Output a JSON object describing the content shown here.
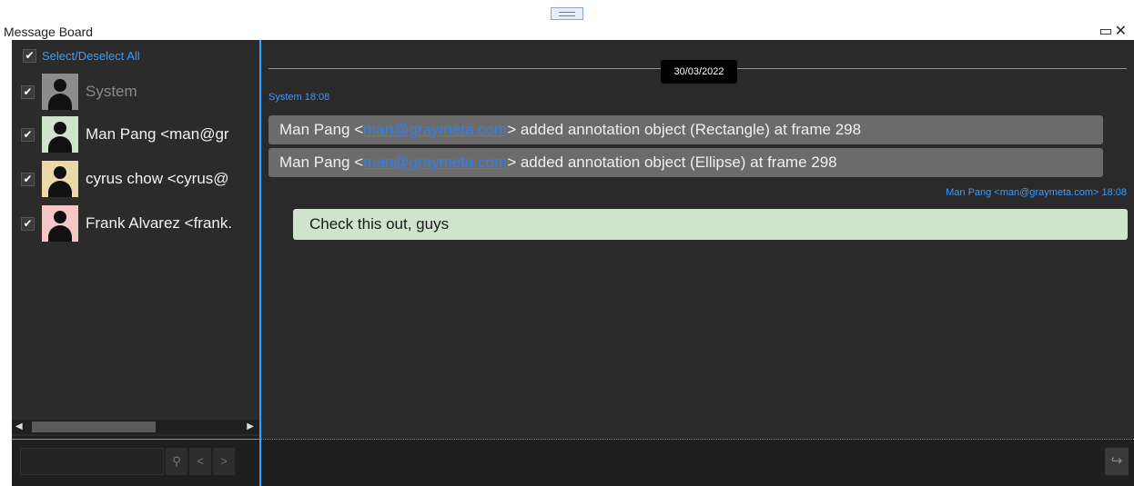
{
  "window": {
    "title": "Message Board",
    "controls": "▭✕"
  },
  "users": {
    "select_all": "Select/Deselect All",
    "items": [
      {
        "name": "System",
        "avatar_color": "#8c8c8c",
        "checked": "✔"
      },
      {
        "name": "Man Pang <man@gr",
        "avatar_color": "#cfe3cd",
        "checked": "✔"
      },
      {
        "name": "cyrus chow <cyrus@",
        "avatar_color": "#ecd9a8",
        "checked": "✔"
      },
      {
        "name": "Frank Alvarez <frank.",
        "avatar_color": "#f7c6c6",
        "checked": "✔"
      }
    ]
  },
  "search": {
    "placeholder": "",
    "search_icon": "search-icon",
    "prev": "<",
    "next": ">"
  },
  "messages": {
    "date": "30/03/2022",
    "system_meta": "System  18:08",
    "system_messages": [
      {
        "prefix": "Man Pang <",
        "email": "man@graymeta.com",
        "suffix": "> added annotation object (Rectangle) at frame 298"
      },
      {
        "prefix": "Man Pang <",
        "email": "man@graymeta.com",
        "suffix": "> added annotation object (Ellipse) at frame 298"
      }
    ],
    "own_meta": "Man Pang <man@graymeta.com>  18:08",
    "own_message": "Check this out, guys"
  },
  "send_icon": "↪"
}
